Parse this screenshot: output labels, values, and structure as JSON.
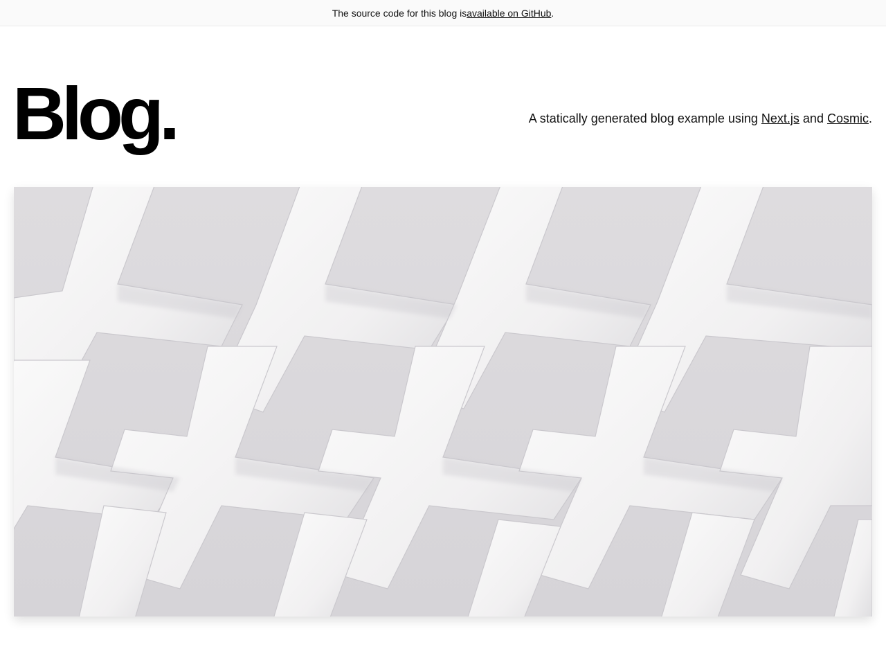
{
  "banner": {
    "text_before": "The source code for this blog is ",
    "link_label": "available on GitHub",
    "text_after": "."
  },
  "header": {
    "brand": "Blog.",
    "tagline_before": "A statically generated blog example using ",
    "tagline_link1": "Next.js",
    "tagline_middle": " and ",
    "tagline_link2": "Cosmic",
    "tagline_after": "."
  },
  "hero": {
    "image_name": "white-lattice-pattern-image"
  },
  "colors": {
    "banner_bg": "#fafafa",
    "border": "#eaeaea",
    "text": "#111111",
    "lattice_light": "#f4f3f4",
    "lattice_shadow": "#c9c7cc"
  }
}
